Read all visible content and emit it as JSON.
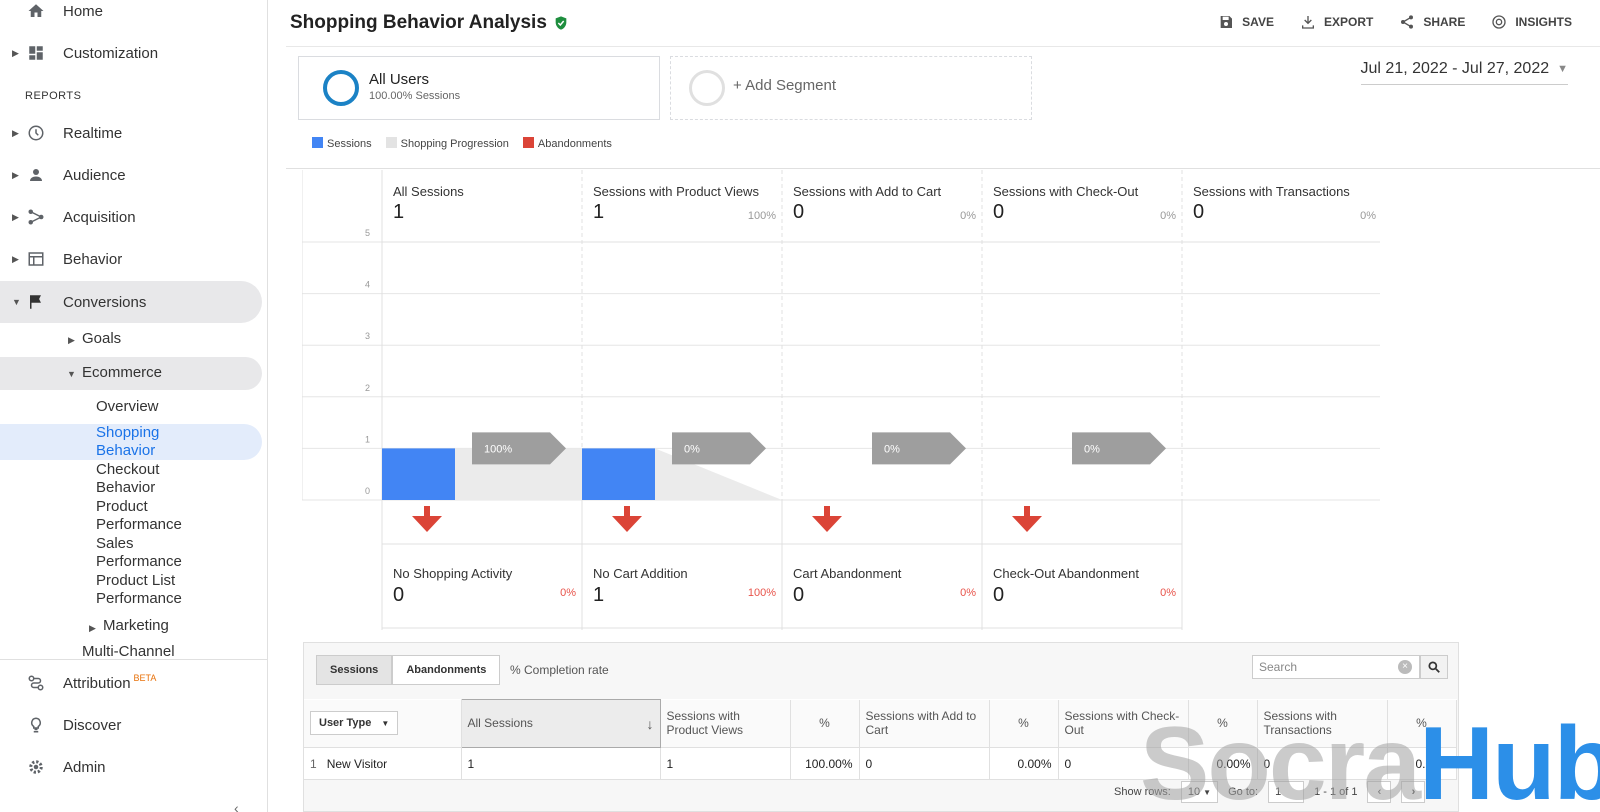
{
  "sidebar": {
    "items_top": [
      {
        "label": "Home",
        "icon": "home-icon"
      },
      {
        "label": "Customization",
        "icon": "dashboard-icon"
      }
    ],
    "section_label": "REPORTS",
    "reports": [
      {
        "label": "Realtime",
        "icon": "clock-icon"
      },
      {
        "label": "Audience",
        "icon": "person-icon"
      },
      {
        "label": "Acquisition",
        "icon": "acquisition-icon"
      },
      {
        "label": "Behavior",
        "icon": "behavior-icon"
      },
      {
        "label": "Conversions",
        "icon": "flag-icon"
      }
    ],
    "conversions_children": {
      "goals": "Goals",
      "ecommerce": "Ecommerce",
      "ecommerce_children": [
        {
          "label": "Overview"
        },
        {
          "label_line1": "Shopping",
          "label_line2": "Behavior"
        },
        {
          "label_line1": "Checkout",
          "label_line2": "Behavior"
        },
        {
          "label_line1": "Product",
          "label_line2": "Performance"
        },
        {
          "label_line1": "Sales",
          "label_line2": "Performance"
        },
        {
          "label_line1": "Product List",
          "label_line2": "Performance"
        }
      ],
      "marketing": "Marketing",
      "multichannel": "Multi-Channel"
    },
    "bottom": [
      {
        "label": "Attribution",
        "badge": "BETA",
        "icon": "attribution-icon"
      },
      {
        "label": "Discover",
        "icon": "lightbulb-icon"
      },
      {
        "label": "Admin",
        "icon": "gear-icon"
      }
    ]
  },
  "header": {
    "title": "Shopping Behavior Analysis",
    "toolbar": {
      "save": "SAVE",
      "export": "EXPORT",
      "share": "SHARE",
      "insights": "INSIGHTS"
    }
  },
  "segments": {
    "active": {
      "name": "All Users",
      "sub": "100.00% Sessions"
    },
    "add": "+ Add Segment"
  },
  "date_range": "Jul 21, 2022 - Jul 27, 2022",
  "legend": [
    {
      "label": "Sessions",
      "color": "#4285f4"
    },
    {
      "label": "Shopping Progression",
      "color": "#e3e3e3"
    },
    {
      "label": "Abandonments",
      "color": "#db4437"
    }
  ],
  "chart_data": {
    "type": "bar",
    "ylim": [
      0,
      5
    ],
    "yticks": [
      "5",
      "4",
      "3",
      "2",
      "1",
      "0"
    ],
    "stages": [
      {
        "label": "All Sessions",
        "value": "1",
        "pct": ""
      },
      {
        "label": "Sessions with Product Views",
        "value": "1",
        "pct": "100%"
      },
      {
        "label": "Sessions with Add to Cart",
        "value": "0",
        "pct": "0%"
      },
      {
        "label": "Sessions with Check-Out",
        "value": "0",
        "pct": "0%"
      },
      {
        "label": "Sessions with Transactions",
        "value": "0",
        "pct": "0%"
      }
    ],
    "values": [
      1,
      1,
      0,
      0,
      0
    ],
    "progression": [
      "100%",
      "0%",
      "0%",
      "0%"
    ],
    "abandonments": [
      {
        "label": "No Shopping Activity",
        "value": "0",
        "pct": "0%"
      },
      {
        "label": "No Cart Addition",
        "value": "1",
        "pct": "100%"
      },
      {
        "label": "Cart Abandonment",
        "value": "0",
        "pct": "0%"
      },
      {
        "label": "Check-Out Abandonment",
        "value": "0",
        "pct": "0%"
      }
    ]
  },
  "table": {
    "tabs": [
      "Sessions",
      "Abandonments"
    ],
    "completion_label": "% Completion rate",
    "search_placeholder": "Search",
    "dimension": "User Type",
    "columns": [
      "All Sessions",
      "Sessions with Product Views",
      "%",
      "Sessions with Add to Cart",
      "%",
      "Sessions with Check-Out",
      "%",
      "Sessions with Transactions",
      "%"
    ],
    "rows": [
      {
        "index": "1",
        "dim": "New Visitor",
        "cells": [
          "1",
          "1",
          "100.00%",
          "0",
          "0.00%",
          "0",
          "0.00%",
          "0",
          "0.00%"
        ]
      }
    ],
    "pager": {
      "show_rows_label": "Show rows:",
      "rows": "10",
      "goto_label": "Go to:",
      "goto_value": "1",
      "range": "1 - 1 of 1"
    }
  },
  "watermark": {
    "part1": "Socra",
    "part2": "Hub"
  }
}
